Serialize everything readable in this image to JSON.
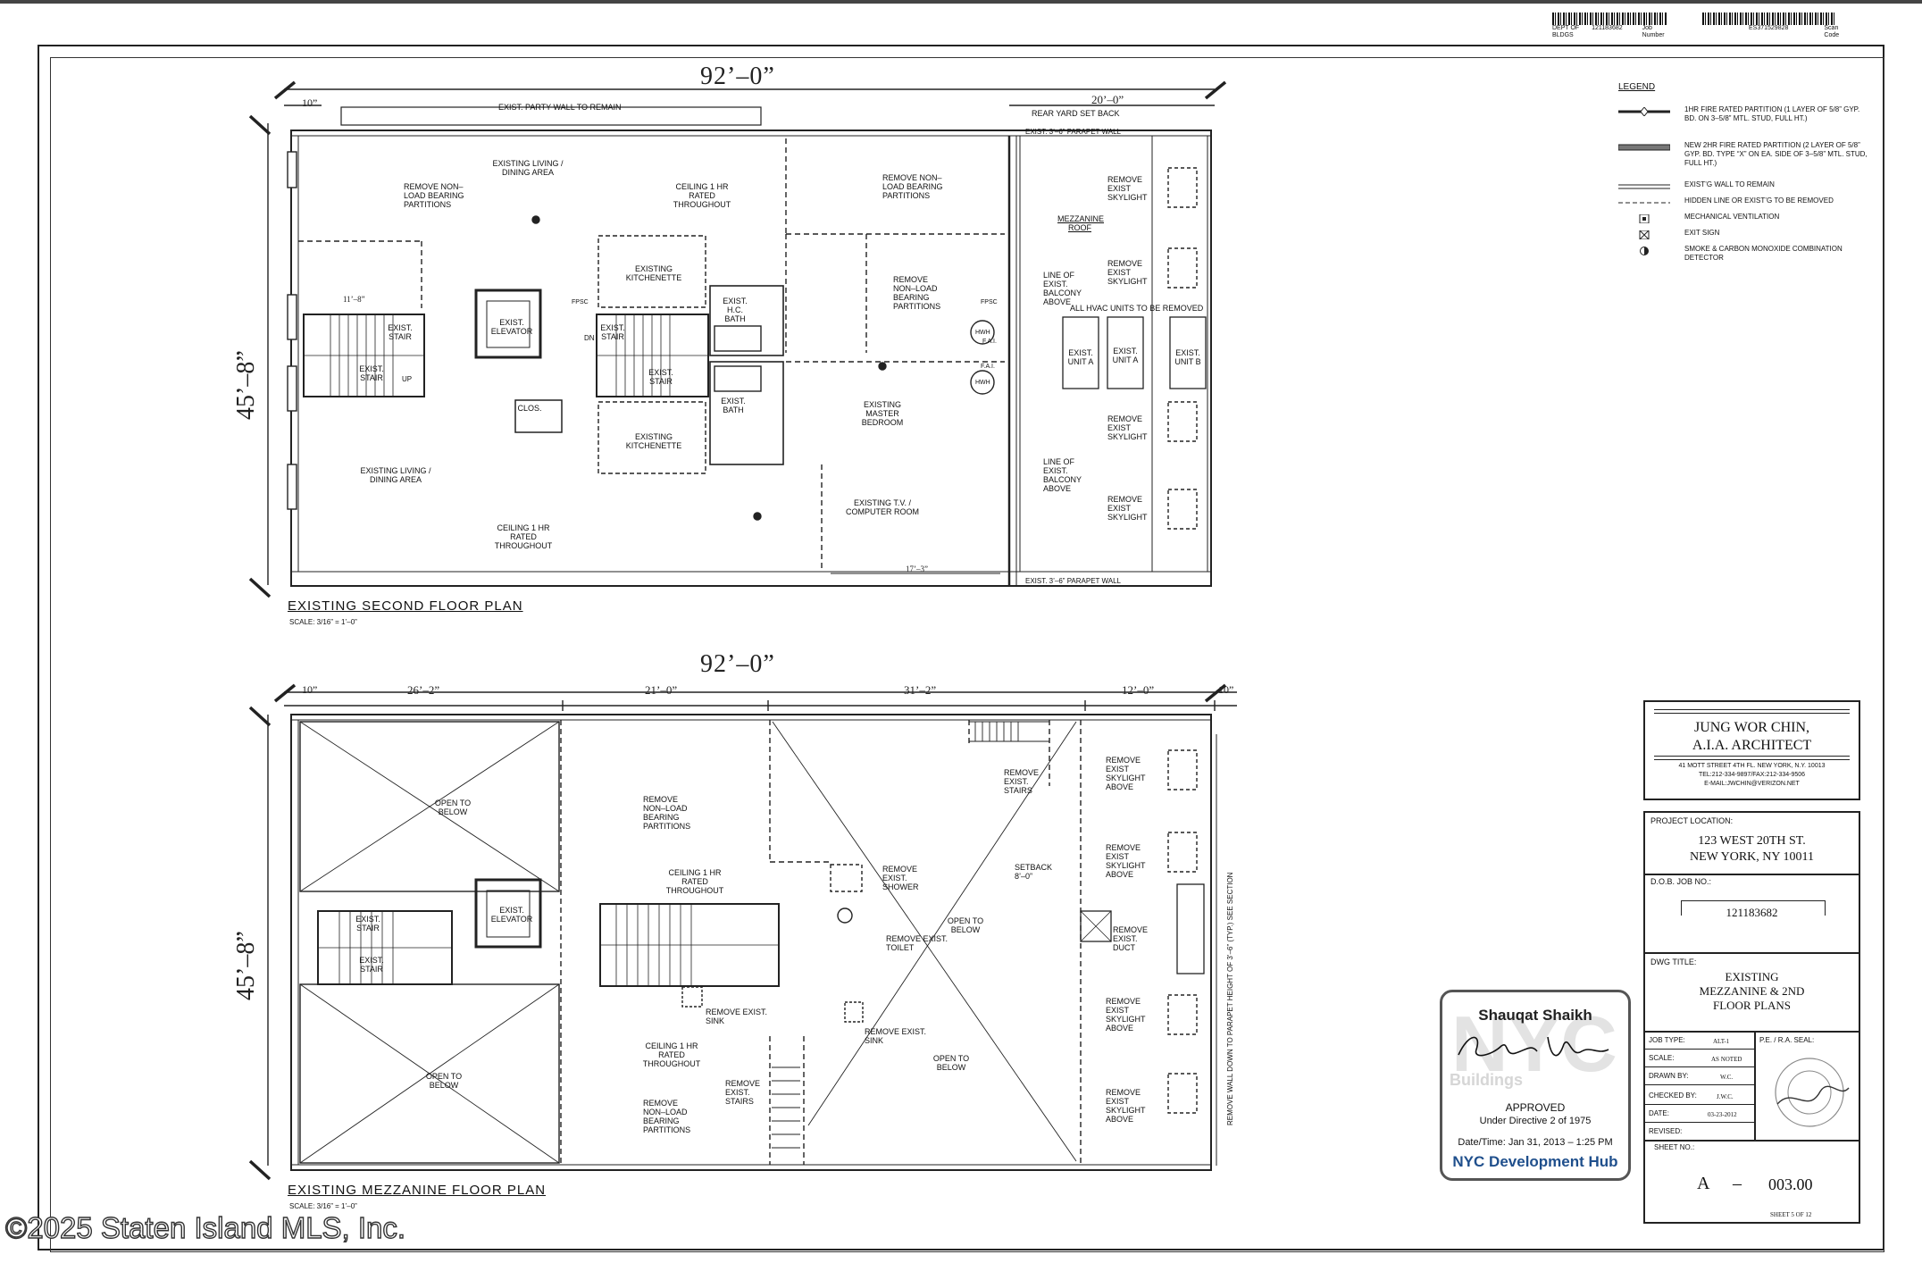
{
  "header": {
    "barcode_left_caption_a": "DEPT OF BLDGS",
    "barcode_left_caption_b": "121183682",
    "barcode_left_caption_c": "Job Number",
    "barcode_right_caption_a": "ES371529828",
    "barcode_right_caption_b": "Scan Code"
  },
  "plan_upper": {
    "overall_width": "92’–0”",
    "overall_depth": "45’–8”",
    "dim_left_offset": "10”",
    "dim_rear_yard": "20’–0”",
    "dim_partition": "11’–8”",
    "dim_bottom": "17’–3”",
    "title": "EXISTING SECOND FLOOR PLAN",
    "scale": "SCALE: 3/16” = 1’–0”",
    "labels": {
      "party_wall": "EXIST. PARTY WALL TO REMAIN",
      "rear_yard": "REAR YARD SET BACK",
      "parapet_top": "EXIST. 3’–6” PARAPET WALL",
      "parapet_bottom": "EXIST. 3’–6” PARAPET WALL",
      "living_top": "EXISTING LIVING / DINING AREA",
      "living_bottom": "EXISTING LIVING / DINING AREA",
      "remove_partitions_1": "REMOVE NON–LOAD BEARING PARTITIONS",
      "remove_partitions_2": "REMOVE NON–LOAD BEARING PARTITIONS",
      "remove_partitions_3": "REMOVE NON–LOAD BEARING PARTITIONS",
      "ceiling_top": "CEILING 1 HR RATED THROUGHOUT",
      "ceiling_bottom": "CEILING 1 HR RATED THROUGHOUT",
      "elevator": "EXIST. ELEVATOR",
      "stair_1": "EXIST. STAIR",
      "stair_2": "EXIST. STAIR",
      "stair_3": "EXIST. STAIR",
      "stair_4": "EXIST. STAIR",
      "kitchenette_1": "EXISTING KITCHENETTE",
      "kitchenette_2": "EXISTING KITCHENETTE",
      "hc_bath": "EXIST. H.C. BATH",
      "bath": "EXIST. BATH",
      "master_bedroom": "EXISTING MASTER BEDROOM",
      "tv_room": "EXISTING T.V. / COMPUTER ROOM",
      "closet": "CLOS.",
      "mezz_roof": "MEZZANINE ROOF",
      "balcony_1": "LINE OF EXIST. BALCONY ABOVE",
      "balcony_2": "LINE OF EXIST. BALCONY ABOVE",
      "hvac_note": "ALL HVAC UNITS TO BE REMOVED",
      "unit_a1": "EXIST. UNIT A",
      "unit_a2": "EXIST. UNIT A",
      "unit_b": "EXIST. UNIT B",
      "skylight": "REMOVE EXIST SKYLIGHT",
      "fpsc": "FPSC",
      "up": "UP",
      "dn": "DN",
      "hwh": "HWH",
      "fai": "F.A.I."
    }
  },
  "plan_lower": {
    "overall_width": "92’–0”",
    "overall_depth": "45’–8”",
    "dim_1": "10”",
    "dim_2": "26’–2”",
    "dim_3": "21’–0”",
    "dim_4": "31’–2”",
    "dim_5": "12’–0”",
    "dim_6": "10”",
    "title": "EXISTING MEZZANINE FLOOR PLAN",
    "scale": "SCALE: 3/16” = 1’–0”",
    "labels": {
      "open_below_1": "OPEN TO BELOW",
      "open_below_2": "OPEN TO BELOW",
      "open_below_3": "OPEN TO BELOW",
      "open_below_4": "OPEN TO BELOW",
      "remove_partitions_1": "REMOVE NON–LOAD BEARING PARTITIONS",
      "remove_partitions_2": "REMOVE NON–LOAD BEARING PARTITIONS",
      "ceiling_1": "CEILING 1 HR RATED THROUGHOUT",
      "ceiling_2": "CEILING 1 HR RATED THROUGHOUT",
      "elevator": "EXIST. ELEVATOR",
      "stair_1": "EXIST. STAIR",
      "stair_2": "EXIST. STAIR",
      "remove_stairs_1": "REMOVE EXIST. STAIRS",
      "remove_stairs_2": "REMOVE EXIST. STAIRS",
      "remove_shower": "REMOVE EXIST. SHOWER",
      "remove_toilet": "REMOVE EXIST. TOILET",
      "remove_sink_1": "REMOVE EXIST. SINK",
      "remove_sink_2": "REMOVE EXIST. SINK",
      "setback": "SETBACK 8’–0”",
      "remove_duct": "REMOVE EXIST. DUCT",
      "skylight": "REMOVE EXIST SKYLIGHT ABOVE",
      "parapet_section": "REMOVE WALL DOWN TO PARAPET HEIGHT OF 3’–6” (TYP.) SEE SECTION"
    }
  },
  "legend": {
    "title": "LEGEND",
    "items": [
      "1HR FIRE RATED PARTITION (1 LAYER OF 5/8” GYP. BD. ON 3–5/8” MTL. STUD, FULL HT.)",
      "NEW 2HR FIRE RATED PARTITION (2 LAYER OF 5/8” GYP. BD. TYPE “X” ON EA. SIDE OF 3–5/8” MTL. STUD, FULL HT.)",
      "EXIST’G WALL TO REMAIN",
      "HIDDEN LINE OR EXIST’G TO BE REMOVED",
      "MECHANICAL VENTILATION",
      "EXIT SIGN",
      "SMOKE & CARBON MONOXIDE COMBINATION DETECTOR"
    ]
  },
  "title_block": {
    "architect_line1": "JUNG WOR CHIN,",
    "architect_line2": "A.I.A. ARCHITECT",
    "address": "41 MOTT STREET 4TH FL. NEW YORK, N.Y. 10013",
    "tel": "TEL:212-334-9897/FAX:212-334-9506",
    "email": "E-MAIL:JWCHIN@VERIZON.NET",
    "project_location_label": "PROJECT LOCATION:",
    "project_line1": "123 WEST 20TH ST.",
    "project_line2": "NEW YORK, NY 10011",
    "dob_label": "D.O.B. JOB NO.:",
    "dob_value": "121183682",
    "dwg_title_label": "DWG TITLE:",
    "dwg_line1": "EXISTING",
    "dwg_line2": "MEZZANINE & 2ND",
    "dwg_line3": "FLOOR PLANS",
    "job_type_label": "JOB TYPE:",
    "job_type_value": "ALT-1",
    "scale_label": "SCALE:",
    "scale_value": "AS NOTED",
    "drawn_label": "DRAWN BY:",
    "drawn_value": "W.C.",
    "checked_label": "CHECKED BY:",
    "checked_value": "J.W.C.",
    "date_label": "DATE:",
    "date_value": "03-23-2012",
    "revised_label": "REVISED:",
    "seal_label": "P.E. / R.A. SEAL:",
    "sheet_no_label": "SHEET NO.:",
    "sheet_no_prefix": "A",
    "sheet_no_dash": "–",
    "sheet_no_value": "003.00",
    "sheet_count": "SHEET 5 OF 12"
  },
  "stamp": {
    "name": "Shauqat Shaikh",
    "agency": "Buildings",
    "status": "APPROVED",
    "directive": "Under Directive 2 of 1975",
    "datetime": "Date/Time: Jan 31, 2013 – 1:25 PM",
    "hub_prefix": "NYC",
    "hub_suffix": "Development Hub"
  },
  "watermark": "©2025 Staten Island MLS, Inc."
}
